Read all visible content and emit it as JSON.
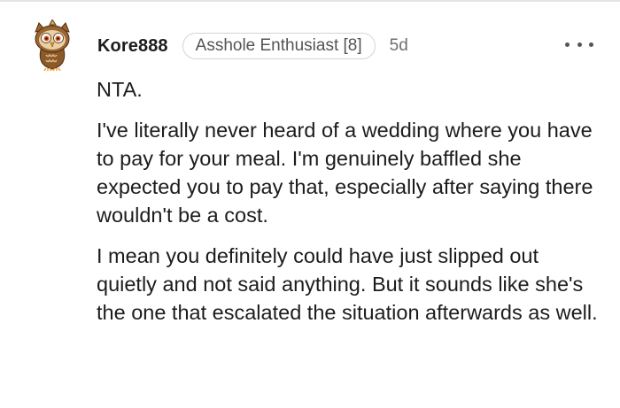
{
  "comment": {
    "author": "Kore888",
    "flair": "Asshole Enthusiast [8]",
    "age": "5d",
    "paragraphs": [
      "NTA.",
      "I've literally never heard of a wedding where you have to pay for your meal. I'm genuinely baffled she expected you to pay that, especially after saying there wouldn't be a cost.",
      "I mean you definitely could have just slipped out quietly and not said anything. But it sounds like she's the one that escalated the situation afterwards as well."
    ]
  },
  "icons": {
    "avatar": "owl-avatar-icon",
    "more": "more-options-icon"
  },
  "colors": {
    "text": "#1c1c1c",
    "muted": "#6e6e6e",
    "flair_border": "#d4d4d4",
    "avatar_brown": "#8a5a2b"
  }
}
